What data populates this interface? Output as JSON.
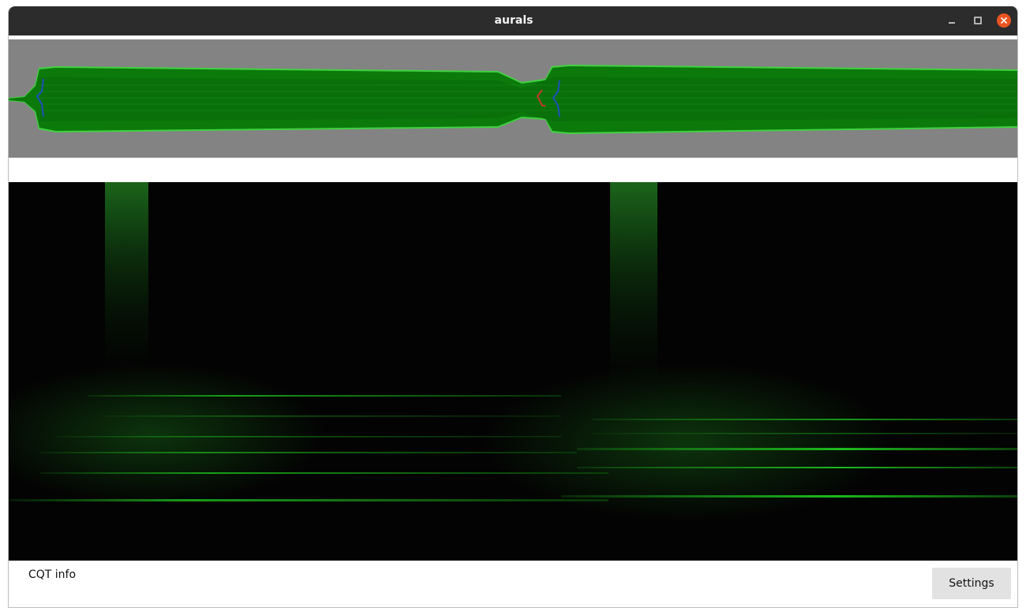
{
  "window": {
    "title": "aurals",
    "controls": [
      "minimize-icon",
      "maximize-icon",
      "close-icon"
    ],
    "close_color": "#e95420"
  },
  "waveform": {
    "background_color": "#838383",
    "fill_color": "#0b7a0b",
    "outline_color": "#3fd23f",
    "marker_colors": [
      "#1f4fbf",
      "#c0392b"
    ]
  },
  "spectrogram": {
    "background_color": "#030303",
    "accent_color": "#1fcf1f"
  },
  "footer": {
    "info_label": "CQT info",
    "settings_label": "Settings"
  }
}
